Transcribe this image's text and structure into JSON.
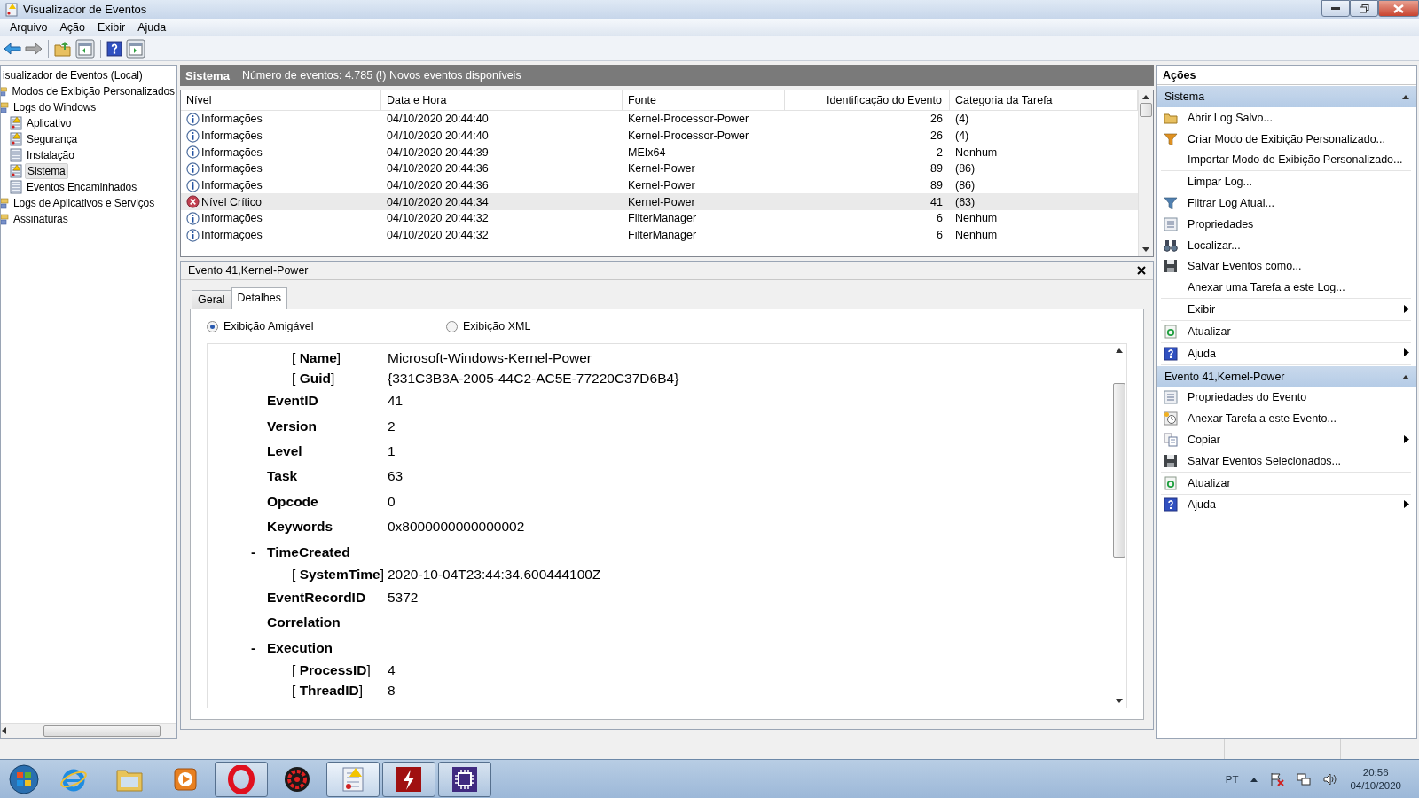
{
  "window": {
    "title": "Visualizador de Eventos"
  },
  "menu": [
    "Arquivo",
    "Ação",
    "Exibir",
    "Ajuda"
  ],
  "tree": {
    "label": "isualizador de Eventos (Local)",
    "children": [
      {
        "kind": "folder",
        "label": "Modos de Exibição Personalizados",
        "selected": false
      },
      {
        "kind": "folder",
        "label": "Logs do Windows",
        "selected": false,
        "children": [
          {
            "kind": "log_warning",
            "label": "Aplicativo",
            "selected": false
          },
          {
            "kind": "log_warning",
            "label": "Segurança",
            "selected": false
          },
          {
            "kind": "log",
            "label": "Instalação",
            "selected": false
          },
          {
            "kind": "log_warning",
            "label": "Sistema",
            "selected": true
          },
          {
            "kind": "log",
            "label": "Eventos Encaminhados",
            "selected": false
          }
        ]
      },
      {
        "kind": "folder",
        "label": "Logs de Aplicativos e Serviços",
        "selected": false
      },
      {
        "kind": "folder",
        "label": "Assinaturas",
        "selected": false
      }
    ]
  },
  "log_header": {
    "title": "Sistema",
    "info": "Número de eventos: 4.785 (!) Novos eventos disponíveis"
  },
  "table": {
    "columns": [
      "Nível",
      "Data e Hora",
      "Fonte",
      "Identificação do Evento",
      "Categoria da Tarefa"
    ],
    "rows": [
      {
        "kind": "info",
        "level": "Informações",
        "date": "04/10/2020 20:44:40",
        "source": "Kernel-Processor-Power",
        "id": "26",
        "category": "(4)",
        "selected": false
      },
      {
        "kind": "info",
        "level": "Informações",
        "date": "04/10/2020 20:44:40",
        "source": "Kernel-Processor-Power",
        "id": "26",
        "category": "(4)",
        "selected": false
      },
      {
        "kind": "info",
        "level": "Informações",
        "date": "04/10/2020 20:44:39",
        "source": "MEIx64",
        "id": "2",
        "category": "Nenhum",
        "selected": false
      },
      {
        "kind": "info",
        "level": "Informações",
        "date": "04/10/2020 20:44:36",
        "source": "Kernel-Power",
        "id": "89",
        "category": "(86)",
        "selected": false
      },
      {
        "kind": "info",
        "level": "Informações",
        "date": "04/10/2020 20:44:36",
        "source": "Kernel-Power",
        "id": "89",
        "category": "(86)",
        "selected": false
      },
      {
        "kind": "critical",
        "level": "Nível Crítico",
        "date": "04/10/2020 20:44:34",
        "source": "Kernel-Power",
        "id": "41",
        "category": "(63)",
        "selected": true
      },
      {
        "kind": "info",
        "level": "Informações",
        "date": "04/10/2020 20:44:32",
        "source": "FilterManager",
        "id": "6",
        "category": "Nenhum",
        "selected": false
      },
      {
        "kind": "info",
        "level": "Informações",
        "date": "04/10/2020 20:44:32",
        "source": "FilterManager",
        "id": "6",
        "category": "Nenhum",
        "selected": false
      }
    ]
  },
  "detail": {
    "title": "Evento 41,Kernel-Power",
    "tabs": [
      {
        "label": "Geral",
        "selected": false
      },
      {
        "label": "Detalhes",
        "selected": true
      }
    ],
    "views": [
      {
        "label": "Exibição Amigável",
        "selected": true
      },
      {
        "label": "Exibição XML",
        "selected": false
      }
    ],
    "rows": [
      {
        "kind": "attr",
        "name": "[ **Name**]",
        "value": "Microsoft-Windows-Kernel-Power"
      },
      {
        "kind": "attr",
        "name": "[ **Guid**]",
        "value": "{331C3B3A-2005-44C2-AC5E-77220C37D6B4}"
      },
      {
        "kind": "field",
        "name": "EventID",
        "value": "41"
      },
      {
        "kind": "field",
        "name": "Version",
        "value": "2"
      },
      {
        "kind": "field",
        "name": "Level",
        "value": "1"
      },
      {
        "kind": "field",
        "name": "Task",
        "value": "63"
      },
      {
        "kind": "field",
        "name": "Opcode",
        "value": "0"
      },
      {
        "kind": "field",
        "name": "Keywords",
        "value": "0x8000000000000002"
      },
      {
        "kind": "group",
        "toggle": "-",
        "name": "TimeCreated"
      },
      {
        "kind": "attr",
        "name": "[ **SystemTime**]",
        "value": "2020-10-04T23:44:34.600444100Z"
      },
      {
        "kind": "field",
        "name": "EventRecordID",
        "value": "5372"
      },
      {
        "kind": "field",
        "name": "Correlation",
        "value": ""
      },
      {
        "kind": "group",
        "toggle": "-",
        "name": "Execution"
      },
      {
        "kind": "attr",
        "name": "[ **ProcessID**]",
        "value": "4"
      },
      {
        "kind": "attr",
        "name": "[ **ThreadID**]",
        "value": "8"
      }
    ]
  },
  "actions": {
    "title": "Ações",
    "sections": [
      {
        "title": "Sistema",
        "groups": [
          [
            {
              "label": "Abrir Log Salvo...",
              "submenu": false
            },
            {
              "label": "Criar Modo de Exibição Personalizado...",
              "submenu": false
            },
            {
              "label": "Importar Modo de Exibição Personalizado...",
              "submenu": false
            }
          ],
          [
            {
              "label": "Limpar Log...",
              "submenu": false
            },
            {
              "label": "Filtrar Log Atual...",
              "submenu": false
            },
            {
              "label": "Propriedades",
              "submenu": false
            },
            {
              "label": "Localizar...",
              "submenu": false
            },
            {
              "label": "Salvar Eventos como...",
              "submenu": false
            },
            {
              "label": "Anexar uma Tarefa a este Log...",
              "submenu": false
            }
          ],
          [
            {
              "label": "Exibir",
              "submenu": true
            }
          ],
          [
            {
              "label": "Atualizar",
              "submenu": false
            }
          ],
          [
            {
              "label": "Ajuda",
              "submenu": true
            }
          ]
        ]
      },
      {
        "title": "Evento 41,Kernel-Power",
        "groups": [
          [
            {
              "label": "Propriedades do Evento",
              "submenu": false
            },
            {
              "label": "Anexar Tarefa a este Evento...",
              "submenu": false
            },
            {
              "label": "Copiar",
              "submenu": true
            },
            {
              "label": "Salvar Eventos Selecionados...",
              "submenu": false
            }
          ],
          [
            {
              "label": "Atualizar",
              "submenu": false
            }
          ],
          [
            {
              "label": "Ajuda",
              "submenu": true
            }
          ]
        ]
      }
    ]
  },
  "taskbar": {
    "apps": [
      {
        "running": false,
        "selected": false
      },
      {
        "running": false,
        "selected": false
      },
      {
        "running": false,
        "selected": false
      },
      {
        "running": false,
        "selected": false
      },
      {
        "running": true,
        "selected": false
      },
      {
        "running": false,
        "selected": false
      },
      {
        "running": true,
        "selected": true
      },
      {
        "running": true,
        "selected": false
      },
      {
        "running": true,
        "selected": false
      }
    ],
    "language": "PT",
    "time": "20:56",
    "date": "04/10/2020"
  }
}
